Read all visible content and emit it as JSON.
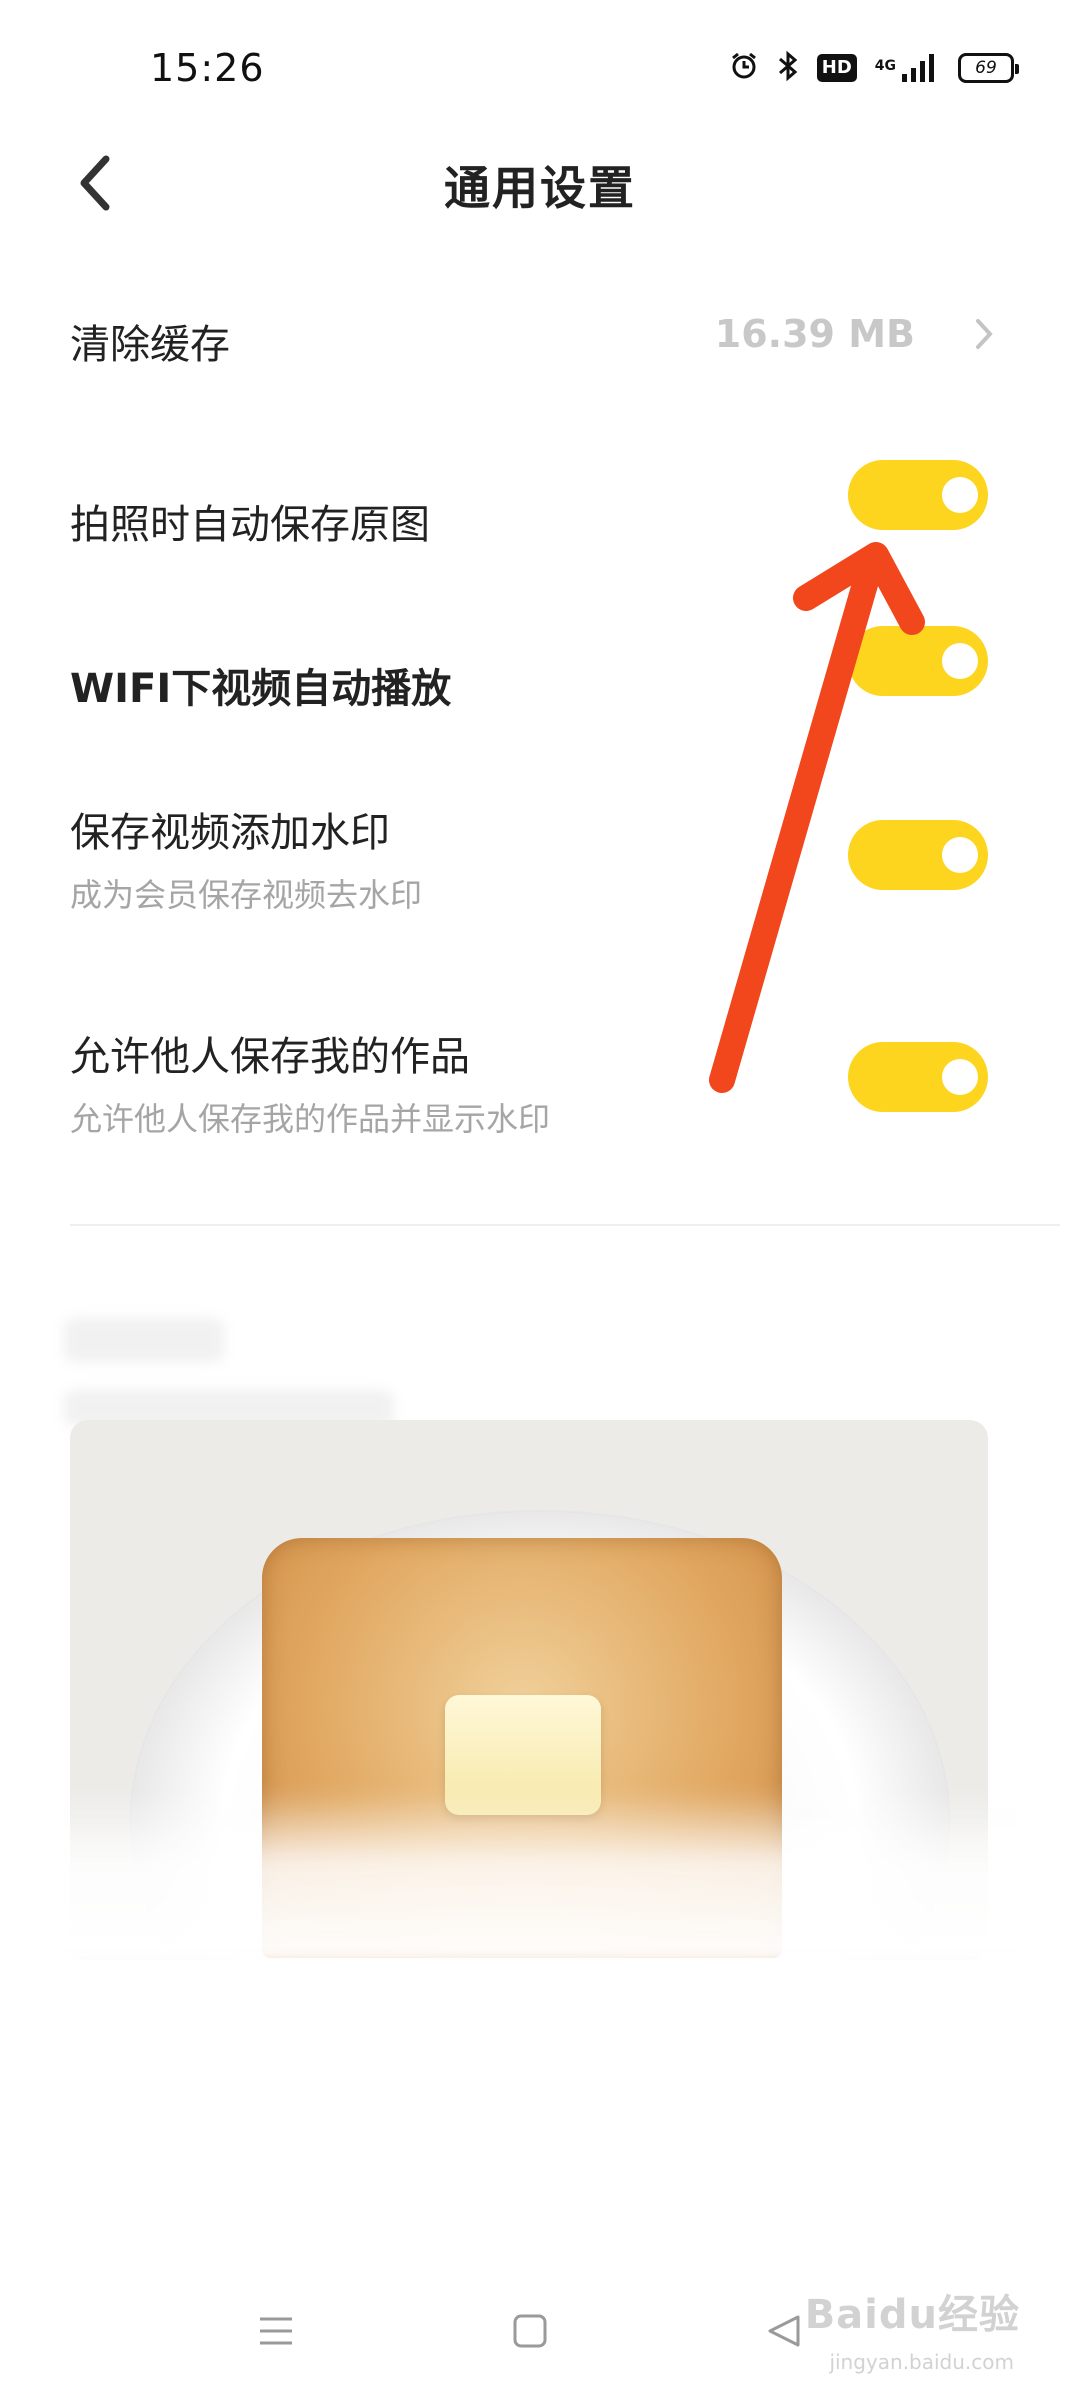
{
  "status_bar": {
    "time": "15:26",
    "network": "4G",
    "hd": "HD",
    "battery": "69"
  },
  "header": {
    "title": "通用设置"
  },
  "settings": {
    "clear_cache": {
      "label": "清除缓存",
      "value": "16.39 MB"
    },
    "auto_save_original": {
      "label": "拍照时自动保存原图",
      "enabled": true
    },
    "wifi_autoplay": {
      "label": "WIFI下视频自动播放",
      "enabled": true
    },
    "save_video_watermark": {
      "label": "保存视频添加水印",
      "sub": "成为会员保存视频去水印",
      "enabled": true
    },
    "allow_others_save": {
      "label": "允许他人保存我的作品",
      "sub": "允许他人保存我的作品并显示水印",
      "enabled": true
    }
  },
  "colors": {
    "toggle_on": "#fdd51e",
    "annotation_arrow": "#f2461c",
    "subtext": "#a5a5a5"
  },
  "watermark": {
    "text": "Baidu经验",
    "sub": "jingyan.baidu.com"
  }
}
